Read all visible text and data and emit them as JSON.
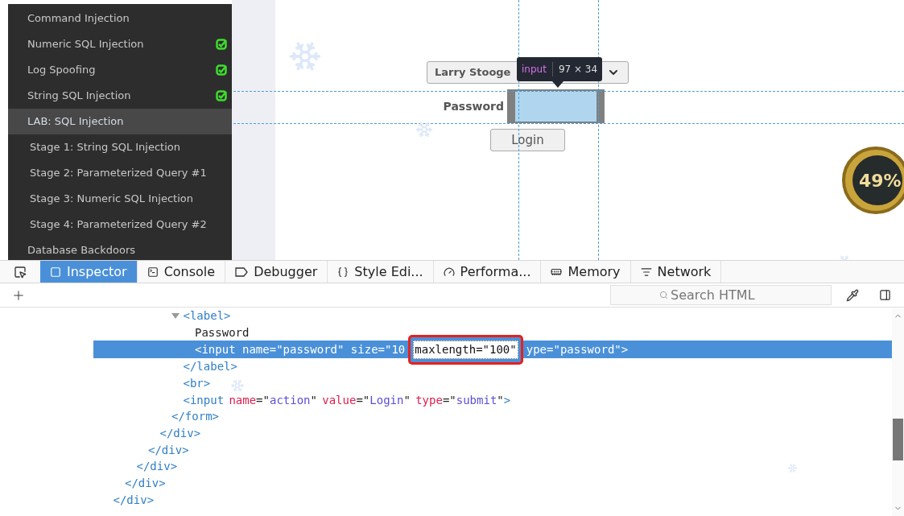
{
  "sidebar": {
    "items": [
      {
        "label": "Command Injection",
        "done": false,
        "selected": false
      },
      {
        "label": "Numeric SQL Injection",
        "done": true,
        "selected": false
      },
      {
        "label": "Log Spoofing",
        "done": true,
        "selected": false
      },
      {
        "label": "String SQL Injection",
        "done": true,
        "selected": false
      },
      {
        "label": "LAB: SQL Injection",
        "done": false,
        "selected": true,
        "children": [
          {
            "label": "Stage 1: String SQL Injection",
            "done": false,
            "selected": false
          },
          {
            "label": "Stage 2: Parameterized Query #1",
            "done": false,
            "selected": false
          },
          {
            "label": "Stage 3: Numeric SQL Injection",
            "done": false,
            "selected": false
          },
          {
            "label": "Stage 4: Parameterized Query #2",
            "done": false,
            "selected": false
          }
        ]
      },
      {
        "label": "Database Backdoors",
        "done": false,
        "selected": false
      }
    ]
  },
  "login_form": {
    "user_select": "Larry Stooge",
    "password_label": "Password",
    "login_button": "Login"
  },
  "highlighter_tooltip": {
    "tag": "input",
    "size": "97 × 34"
  },
  "badge": {
    "text": "49%"
  },
  "devtools": {
    "tabs": [
      {
        "label": "Inspector",
        "selected": true
      },
      {
        "label": "Console",
        "selected": false
      },
      {
        "label": "Debugger",
        "selected": false
      },
      {
        "label": "Style Edi...",
        "selected": false
      },
      {
        "label": "Performa...",
        "selected": false
      },
      {
        "label": "Memory",
        "selected": false
      },
      {
        "label": "Network",
        "selected": false
      }
    ],
    "search": {
      "placeholder": "Search HTML"
    },
    "markup": [
      {
        "children": [
          {
            "children": [
              {
                "children": [
                  {
                    "children": [
                      {
                        "children": [
                          {
                            "children": [
                              {
                                "children": [
                                  {
                                    "parts": [
                                      {
                                        "kind": "tag",
                                        "text": "<label>"
                                      }
                                    ],
                                    "expanded": true,
                                    "children": [
                                      {
                                        "parts": [
                                          {
                                            "kind": "text",
                                            "text": "Password"
                                          }
                                        ]
                                      },
                                      {
                                        "selected": true,
                                        "parts": [
                                          {
                                            "kind": "tag",
                                            "text": "<input name=\"password\" size=\"10"
                                          },
                                          {
                                            "kind": "edit",
                                            "text": "maxlength=\"100\""
                                          },
                                          {
                                            "kind": "tag",
                                            "text": "ype=\"password\">"
                                          }
                                        ]
                                      }
                                    ]
                                  },
                                  {
                                    "parts": [
                                      {
                                        "kind": "tag",
                                        "text": "</label>"
                                      }
                                    ]
                                  },
                                  {
                                    "parts": [
                                      {
                                        "kind": "tag",
                                        "text": "<br>"
                                      }
                                    ]
                                  },
                                  {
                                    "parts": [
                                      {
                                        "kind": "tag",
                                        "text": "<input"
                                      },
                                      {
                                        "kind": "attr",
                                        "text": "name"
                                      },
                                      {
                                        "kind": "punct",
                                        "text": "=\""
                                      },
                                      {
                                        "kind": "value",
                                        "text": "action"
                                      },
                                      {
                                        "kind": "punct",
                                        "text": "\""
                                      },
                                      {
                                        "kind": "attr",
                                        "text": "value"
                                      },
                                      {
                                        "kind": "punct",
                                        "text": "=\""
                                      },
                                      {
                                        "kind": "value",
                                        "text": "Login"
                                      },
                                      {
                                        "kind": "punct",
                                        "text": "\""
                                      },
                                      {
                                        "kind": "attr",
                                        "text": "type"
                                      },
                                      {
                                        "kind": "punct",
                                        "text": "=\""
                                      },
                                      {
                                        "kind": "value",
                                        "text": "submit"
                                      },
                                      {
                                        "kind": "punct",
                                        "text": "\""
                                      },
                                      {
                                        "kind": "tag",
                                        "text": ">"
                                      }
                                    ]
                                  }
                                ]
                              },
                              {
                                "parts": [
                                  {
                                    "kind": "tag",
                                    "text": "</form>"
                                  }
                                ]
                              }
                            ]
                          },
                          {
                            "parts": [
                              {
                                "kind": "tag",
                                "text": "</div>"
                              }
                            ]
                          }
                        ]
                      },
                      {
                        "parts": [
                          {
                            "kind": "tag",
                            "text": "</div>"
                          }
                        ]
                      }
                    ]
                  },
                  {
                    "parts": [
                      {
                        "kind": "tag",
                        "text": "</div>"
                      }
                    ]
                  }
                ]
              },
              {
                "parts": [
                  {
                    "kind": "tag",
                    "text": "</div>"
                  }
                ]
              }
            ]
          },
          {
            "parts": [
              {
                "kind": "tag",
                "text": "</div>"
              }
            ]
          }
        ]
      }
    ]
  }
}
